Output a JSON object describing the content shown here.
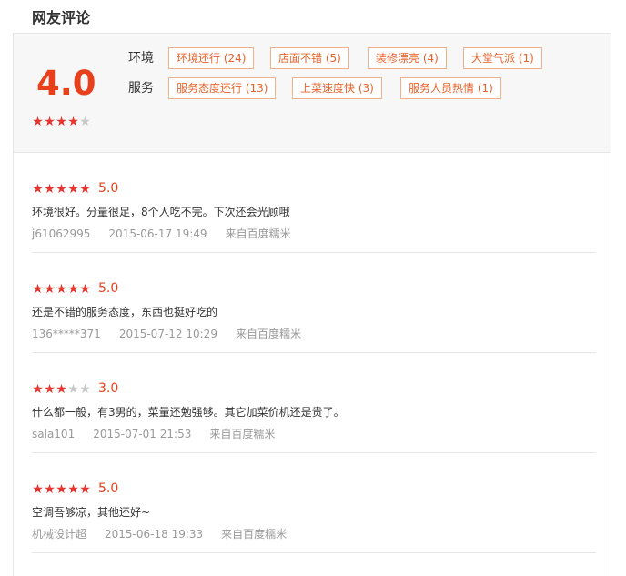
{
  "section": {
    "title": "网友评论"
  },
  "summary": {
    "score": "4.0",
    "stars": 4,
    "tag_groups": [
      {
        "label": "环境",
        "tags": [
          "环境还行 (24)",
          "店面不错 (5)",
          "装修漂亮 (4)",
          "大堂气派 (1)"
        ]
      },
      {
        "label": "服务",
        "tags": [
          "服务态度还行 (13)",
          "上菜速度快 (3)",
          "服务人员热情 (1)"
        ]
      }
    ]
  },
  "reviews": [
    {
      "stars": 5,
      "score": "5.0",
      "content": "环境很好。分量很足，8个人吃不完。下次还会光顾哦",
      "user": "j61062995",
      "date": "2015-06-17 19:49",
      "source": "来自百度糯米"
    },
    {
      "stars": 5,
      "score": "5.0",
      "content": "还是不错的服务态度，东西也挺好吃的",
      "user": "136*****371",
      "date": "2015-07-12 10:29",
      "source": "来自百度糯米"
    },
    {
      "stars": 3,
      "score": "3.0",
      "content": "什么都一般，有3男的，菜量还勉强够。其它加菜价机还是贵了。",
      "user": "sala101",
      "date": "2015-07-01 21:53",
      "source": "来自百度糯米"
    },
    {
      "stars": 5,
      "score": "5.0",
      "content": "空调吾够凉，其他还好~",
      "user": "机械设计超",
      "date": "2015-06-18 19:33",
      "source": "来自百度糯米"
    }
  ],
  "icons": {
    "star_filled": "star-filled-icon",
    "star_empty": "star-empty-icon"
  },
  "colors": {
    "accent": "#e8401c",
    "star": "#e8342f",
    "tag_border": "#f0b089",
    "tag_text": "#e8612a"
  }
}
